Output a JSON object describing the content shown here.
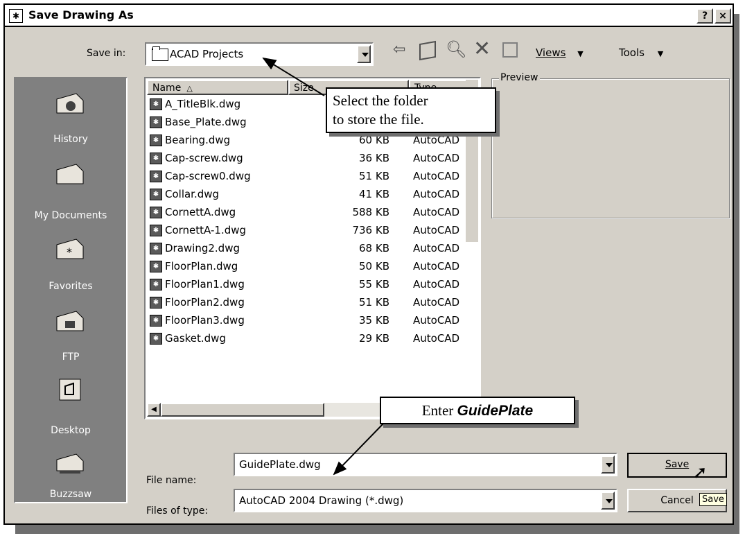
{
  "window": {
    "title": "Save Drawing As",
    "help_label": "?",
    "close_label": "×"
  },
  "toolbar": {
    "save_in_label": "Save in:",
    "save_in_value": "ACAD Projects",
    "views_label": "Views",
    "tools_label": "Tools"
  },
  "places": [
    "History",
    "My Documents",
    "Favorites",
    "FTP",
    "Desktop",
    "Buzzsaw"
  ],
  "file_list": {
    "headers": {
      "name": "Name",
      "size": "Size",
      "type": "Type"
    },
    "rows": [
      {
        "name": "A_TitleBlk.dwg",
        "size": "",
        "type": ""
      },
      {
        "name": "Base_Plate.dwg",
        "size": "",
        "type": ""
      },
      {
        "name": "Bearing.dwg",
        "size": "60 KB",
        "type": "AutoCAD"
      },
      {
        "name": "Cap-screw.dwg",
        "size": "36 KB",
        "type": "AutoCAD"
      },
      {
        "name": "Cap-screw0.dwg",
        "size": "51 KB",
        "type": "AutoCAD"
      },
      {
        "name": "Collar.dwg",
        "size": "41 KB",
        "type": "AutoCAD"
      },
      {
        "name": "CornettA.dwg",
        "size": "588 KB",
        "type": "AutoCAD"
      },
      {
        "name": "CornettA-1.dwg",
        "size": "736 KB",
        "type": "AutoCAD"
      },
      {
        "name": "Drawing2.dwg",
        "size": "68 KB",
        "type": "AutoCAD"
      },
      {
        "name": "FloorPlan.dwg",
        "size": "50 KB",
        "type": "AutoCAD"
      },
      {
        "name": "FloorPlan1.dwg",
        "size": "55 KB",
        "type": "AutoCAD"
      },
      {
        "name": "FloorPlan2.dwg",
        "size": "51 KB",
        "type": "AutoCAD"
      },
      {
        "name": "FloorPlan3.dwg",
        "size": "35 KB",
        "type": "AutoCAD"
      },
      {
        "name": "Gasket.dwg",
        "size": "29 KB",
        "type": "AutoCAD"
      }
    ]
  },
  "preview": {
    "label": "Preview"
  },
  "form": {
    "file_name_label": "File name:",
    "file_name_value": "GuidePlate.dwg",
    "file_type_label": "Files of type:",
    "file_type_value": "AutoCAD 2004 Drawing (*.dwg)"
  },
  "buttons": {
    "save": "Save",
    "cancel": "Cancel",
    "tooltip": "Save"
  },
  "callouts": {
    "folder_line1": "Select the folder",
    "folder_line2": "to store the file.",
    "enter_prefix": "Enter ",
    "enter_value": "GuidePlate"
  }
}
